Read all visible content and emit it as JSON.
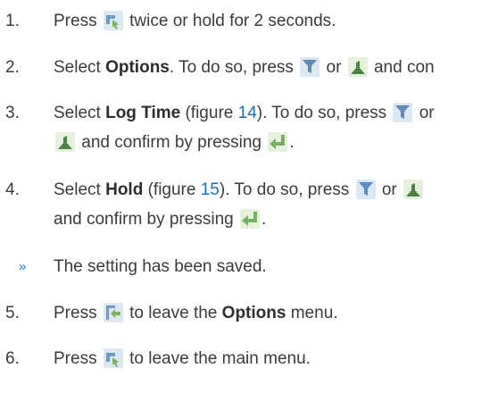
{
  "steps": [
    {
      "num": "1.",
      "a": "Press",
      "b": "twice or hold for 2 seconds."
    },
    {
      "num": "2.",
      "a": "Select",
      "bold": "Options",
      "b": ". To do so, press",
      "c": "or",
      "d": "and con"
    },
    {
      "num": "3.",
      "a": "Select",
      "bold": "Log Time",
      "b": "(figure",
      "ref": "14",
      "c": "). To do so, press",
      "d": "or",
      "e": "and confirm by pressing",
      "f": "."
    },
    {
      "num": "4.",
      "a": "Select",
      "bold": "Hold",
      "b": "(figure",
      "ref": "15",
      "c": "). To do so, press",
      "d": "or",
      "e": "and confirm by pressing",
      "f": "."
    },
    {
      "num": "5.",
      "a": "Press",
      "b": "to leave the",
      "bold": "Options",
      "c": "menu."
    },
    {
      "num": "6.",
      "a": "Press",
      "b": "to leave the main menu."
    }
  ],
  "result": {
    "marker": "»",
    "text": "The setting has been saved."
  },
  "icons": {
    "menu": "menu-icon",
    "down": "down-arrow-icon",
    "up": "up-arrow-icon",
    "enter": "enter-icon",
    "back": "back-icon"
  },
  "colors": {
    "text": "#3b3b3b",
    "accent": "#1d6fb8",
    "icon_blue": "#6aa3d6",
    "icon_green": "#77b552"
  }
}
